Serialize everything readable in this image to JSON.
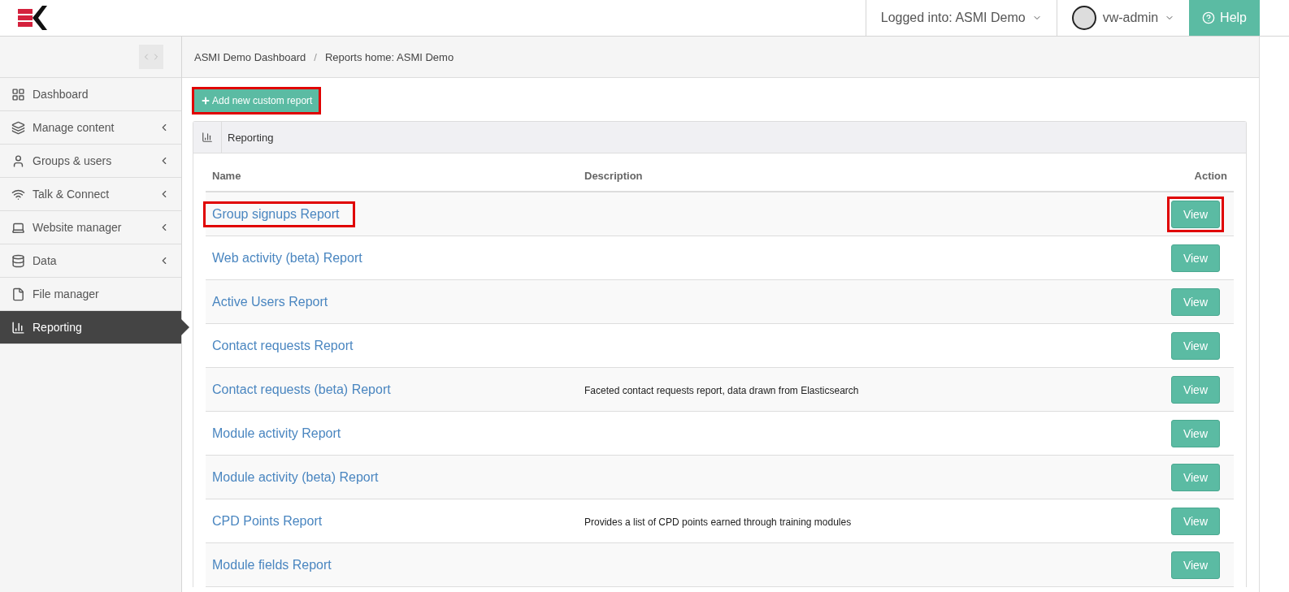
{
  "header": {
    "logged_into": "Logged into: ASMI Demo",
    "user": "vw-admin",
    "help": "Help"
  },
  "sidebar": {
    "items": [
      {
        "label": "Dashboard",
        "expandable": false,
        "selected": false
      },
      {
        "label": "Manage content",
        "expandable": true,
        "selected": false
      },
      {
        "label": "Groups & users",
        "expandable": true,
        "selected": false
      },
      {
        "label": "Talk & Connect",
        "expandable": true,
        "selected": false
      },
      {
        "label": "Website manager",
        "expandable": true,
        "selected": false
      },
      {
        "label": "Data",
        "expandable": true,
        "selected": false
      },
      {
        "label": "File manager",
        "expandable": false,
        "selected": false
      },
      {
        "label": "Reporting",
        "expandable": false,
        "selected": true
      }
    ]
  },
  "breadcrumbs": {
    "items": [
      "ASMI Demo Dashboard",
      "Reports home: ASMI Demo"
    ],
    "separator": "/"
  },
  "add_button": {
    "label": "Add new custom report",
    "highlighted": true
  },
  "panel": {
    "title": "Reporting"
  },
  "table": {
    "columns": [
      "Name",
      "Description",
      "Action"
    ],
    "rows": [
      {
        "name": "Group signups Report",
        "description": "",
        "action": "View",
        "name_highlighted": true,
        "action_highlighted": true
      },
      {
        "name": "Web activity (beta) Report",
        "description": "",
        "action": "View",
        "name_highlighted": false,
        "action_highlighted": false
      },
      {
        "name": "Active Users Report",
        "description": "",
        "action": "View",
        "name_highlighted": false,
        "action_highlighted": false
      },
      {
        "name": "Contact requests Report",
        "description": "",
        "action": "View",
        "name_highlighted": false,
        "action_highlighted": false
      },
      {
        "name": "Contact requests (beta) Report",
        "description": "Faceted contact requests report, data drawn from Elasticsearch",
        "action": "View",
        "name_highlighted": false,
        "action_highlighted": false
      },
      {
        "name": "Module activity Report",
        "description": "",
        "action": "View",
        "name_highlighted": false,
        "action_highlighted": false
      },
      {
        "name": "Module activity (beta) Report",
        "description": "",
        "action": "View",
        "name_highlighted": false,
        "action_highlighted": false
      },
      {
        "name": "CPD Points Report",
        "description": "Provides a list of CPD points earned through training modules",
        "action": "View",
        "name_highlighted": false,
        "action_highlighted": false
      },
      {
        "name": "Module fields Report",
        "description": "",
        "action": "View",
        "name_highlighted": false,
        "action_highlighted": false
      }
    ]
  }
}
